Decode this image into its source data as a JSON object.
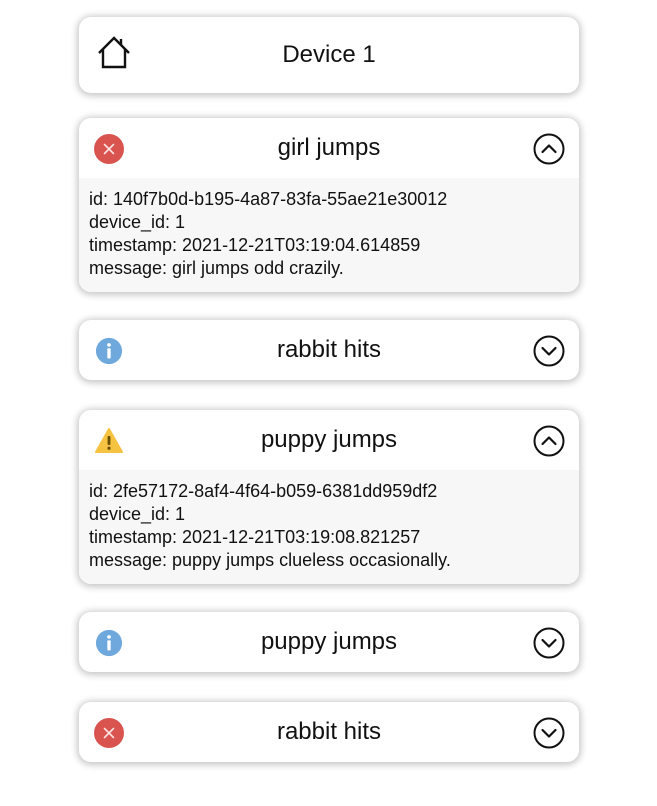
{
  "header": {
    "title": "Device 1",
    "icon": "home-icon"
  },
  "colors": {
    "error": "#d9534f",
    "info": "#6fa8dc",
    "warning": "#f5c242",
    "card_bg": "#ffffff",
    "details_bg": "#f7f7f7"
  },
  "events": [
    {
      "title": "girl jumps",
      "level": "error",
      "icon": "error-icon",
      "expanded": true,
      "toggle_icon": "chevron-up-circle-icon",
      "details": {
        "id": "id: 140f7b0d-b195-4a87-83fa-55ae21e30012",
        "device_id": "device_id: 1",
        "timestamp": "timestamp: 2021-12-21T03:19:04.614859",
        "message": "message: girl jumps odd crazily."
      }
    },
    {
      "title": "rabbit hits",
      "level": "info",
      "icon": "info-icon",
      "expanded": false,
      "toggle_icon": "chevron-down-circle-icon"
    },
    {
      "title": "puppy jumps",
      "level": "warning",
      "icon": "warning-icon",
      "expanded": true,
      "toggle_icon": "chevron-up-circle-icon",
      "details": {
        "id": "id: 2fe57172-8af4-4f64-b059-6381dd959df2",
        "device_id": "device_id: 1",
        "timestamp": "timestamp: 2021-12-21T03:19:08.821257",
        "message": "message: puppy jumps clueless occasionally."
      }
    },
    {
      "title": "puppy jumps",
      "level": "info",
      "icon": "info-icon",
      "expanded": false,
      "toggle_icon": "chevron-down-circle-icon"
    },
    {
      "title": "rabbit hits",
      "level": "error",
      "icon": "error-icon",
      "expanded": false,
      "toggle_icon": "chevron-down-circle-icon"
    }
  ]
}
